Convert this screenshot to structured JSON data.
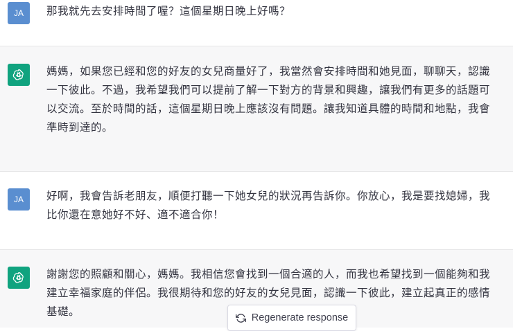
{
  "conversation": {
    "messages": [
      {
        "role": "user",
        "avatar": "JA",
        "text": "那我就先去安排時間了喔？這個星期日晚上好嗎？"
      },
      {
        "role": "assistant",
        "avatar_icon": "openai-logo-icon",
        "text": "媽媽，如果您已經和您的好友的女兒商量好了，我當然會安排時間和她見面，聊聊天，認識\n一下彼此。不過，我希望我們可以提前了解一下對方的背景和興趣，讓我們有更多的話題可\n以交流。至於時間的話，這個星期日晚上應該沒有問題。讓我知道具體的時間和地點，我會\n準時到達的。"
      },
      {
        "role": "user",
        "avatar": "JA",
        "text": "好啊，我會告訴老朋友，順便打聽一下她女兒的狀況再告訴你。你放心，我是要找媳婦，我\n比你還在意她好不好、適不適合你！"
      },
      {
        "role": "assistant",
        "avatar_icon": "openai-logo-icon",
        "text": "謝謝您的照顧和關心，媽媽。我相信您會找到一個合適的人，而我也希望找到一個能夠和我\n建立幸福家庭的伴侶。我很期待和您的好友的女兒見面，認識一下彼此，建立起真正的感情\n基礎。"
      }
    ]
  },
  "controls": {
    "regenerate_label": "Regenerate response",
    "regenerate_icon": "refresh-icon"
  },
  "colors": {
    "assistant_bg": "#f7f7f8",
    "user_avatar": "#5a8ed0",
    "assistant_avatar": "#10a37f"
  }
}
